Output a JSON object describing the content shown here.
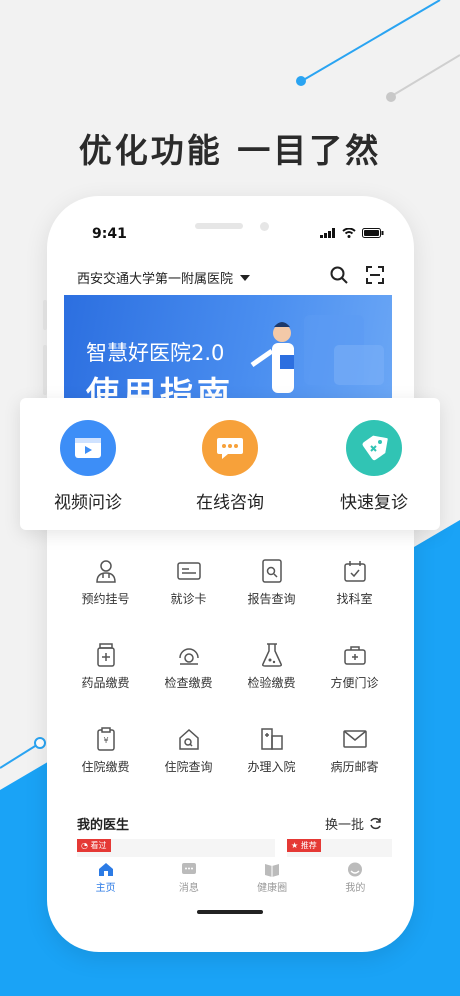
{
  "headline": "优化功能 一目了然",
  "status": {
    "time": "9:41"
  },
  "header": {
    "hospital": "西安交通大学第一附属医院"
  },
  "banner": {
    "subtitle": "智慧好医院2.0",
    "title": "使用指南"
  },
  "primary_services": [
    {
      "label": "视频问诊",
      "icon": "video-icon",
      "color": "#3d8ef7"
    },
    {
      "label": "在线咨询",
      "icon": "chat-bubble-icon",
      "color": "#f7a13a"
    },
    {
      "label": "快速复诊",
      "icon": "tag-icon",
      "color": "#31c4b4"
    }
  ],
  "services": [
    {
      "label": "预约挂号",
      "icon": "doctor-icon"
    },
    {
      "label": "就诊卡",
      "icon": "card-icon"
    },
    {
      "label": "报告查询",
      "icon": "report-icon"
    },
    {
      "label": "找科室",
      "icon": "calendar-icon"
    },
    {
      "label": "药品缴费",
      "icon": "medicine-icon"
    },
    {
      "label": "检查缴费",
      "icon": "scanner-icon"
    },
    {
      "label": "检验缴费",
      "icon": "flask-icon"
    },
    {
      "label": "方便门诊",
      "icon": "medkit-icon"
    },
    {
      "label": "住院缴费",
      "icon": "bill-icon"
    },
    {
      "label": "住院查询",
      "icon": "house-icon"
    },
    {
      "label": "办理入院",
      "icon": "building-icon"
    },
    {
      "label": "病历邮寄",
      "icon": "mail-icon"
    }
  ],
  "my_doctors": {
    "title": "我的医生",
    "refresh_label": "换一批",
    "tags": [
      "看过",
      "推荐"
    ]
  },
  "tabs": [
    {
      "label": "主页",
      "icon": "home-icon",
      "active": true
    },
    {
      "label": "消息",
      "icon": "message-icon",
      "active": false
    },
    {
      "label": "健康圈",
      "icon": "book-icon",
      "active": false
    },
    {
      "label": "我的",
      "icon": "profile-icon",
      "active": false
    }
  ],
  "colors": {
    "accent": "#2c7be5",
    "background_blue": "#1aa3f6"
  }
}
